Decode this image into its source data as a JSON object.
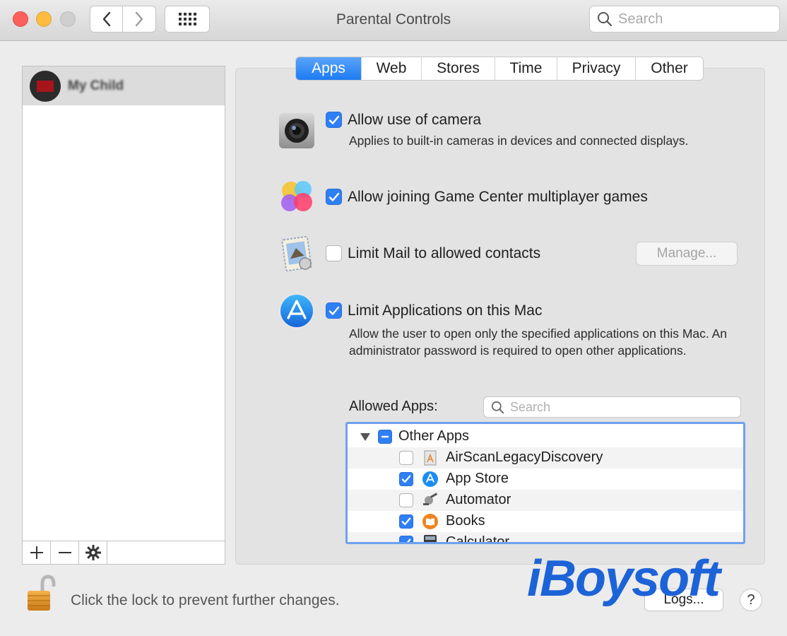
{
  "window": {
    "title": "Parental Controls",
    "search_placeholder": "Search"
  },
  "sidebar": {
    "user_name": "My Child",
    "toolbar": {
      "add": "+",
      "remove": "−",
      "settings": "⚙"
    }
  },
  "tabs": [
    {
      "label": "Apps",
      "active": true
    },
    {
      "label": "Web",
      "active": false
    },
    {
      "label": "Stores",
      "active": false
    },
    {
      "label": "Time",
      "active": false
    },
    {
      "label": "Privacy",
      "active": false
    },
    {
      "label": "Other",
      "active": false
    }
  ],
  "options": {
    "camera": {
      "label": "Allow use of camera",
      "desc": "Applies to built-in cameras in devices and connected displays.",
      "checked": true,
      "icon": "camera-icon"
    },
    "gamecenter": {
      "label": "Allow joining Game Center multiplayer games",
      "checked": true,
      "icon": "game-center-icon"
    },
    "mail": {
      "label": "Limit Mail to allowed contacts",
      "checked": false,
      "icon": "mail-icon",
      "manage_label": "Manage..."
    },
    "apps": {
      "label": "Limit Applications on this Mac",
      "desc": "Allow the user to open only the specified applications on this Mac. An administrator password is required to open other applications.",
      "checked": true,
      "icon": "app-store-icon"
    }
  },
  "allowed_apps": {
    "label": "Allowed Apps:",
    "search_placeholder": "Search",
    "group": {
      "name": "Other Apps",
      "state": "mixed",
      "expanded": true
    },
    "items": [
      {
        "name": "AirScanLegacyDiscovery",
        "checked": false,
        "icon": "airscan-icon"
      },
      {
        "name": "App Store",
        "checked": true,
        "icon": "app-store-icon"
      },
      {
        "name": "Automator",
        "checked": false,
        "icon": "automator-icon"
      },
      {
        "name": "Books",
        "checked": true,
        "icon": "books-icon"
      },
      {
        "name": "Calculator",
        "checked": true,
        "icon": "calculator-icon"
      }
    ]
  },
  "footer": {
    "lock_text": "Click the lock to prevent further changes.",
    "logs_label": "Logs...",
    "help_label": "?"
  },
  "watermark": "iBoysoft",
  "colors": {
    "accent": "#2f7ff5",
    "focus_ring": "#6ea1ef"
  }
}
